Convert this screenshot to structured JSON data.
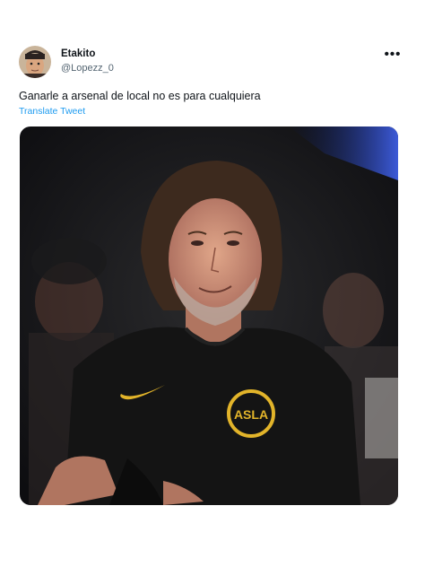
{
  "tweet": {
    "author_name": "Etakito",
    "author_handle": "@Lopezz_0",
    "more_icon": "more-horizontal-icon",
    "text": "Ganarle a arsenal de local no es para cualquiera",
    "translate_label": "Translate Tweet"
  },
  "media": {
    "crest_text": "ASLA"
  },
  "colors": {
    "link": "#1d9bf0",
    "text": "#0f1419",
    "muted": "#536471"
  }
}
